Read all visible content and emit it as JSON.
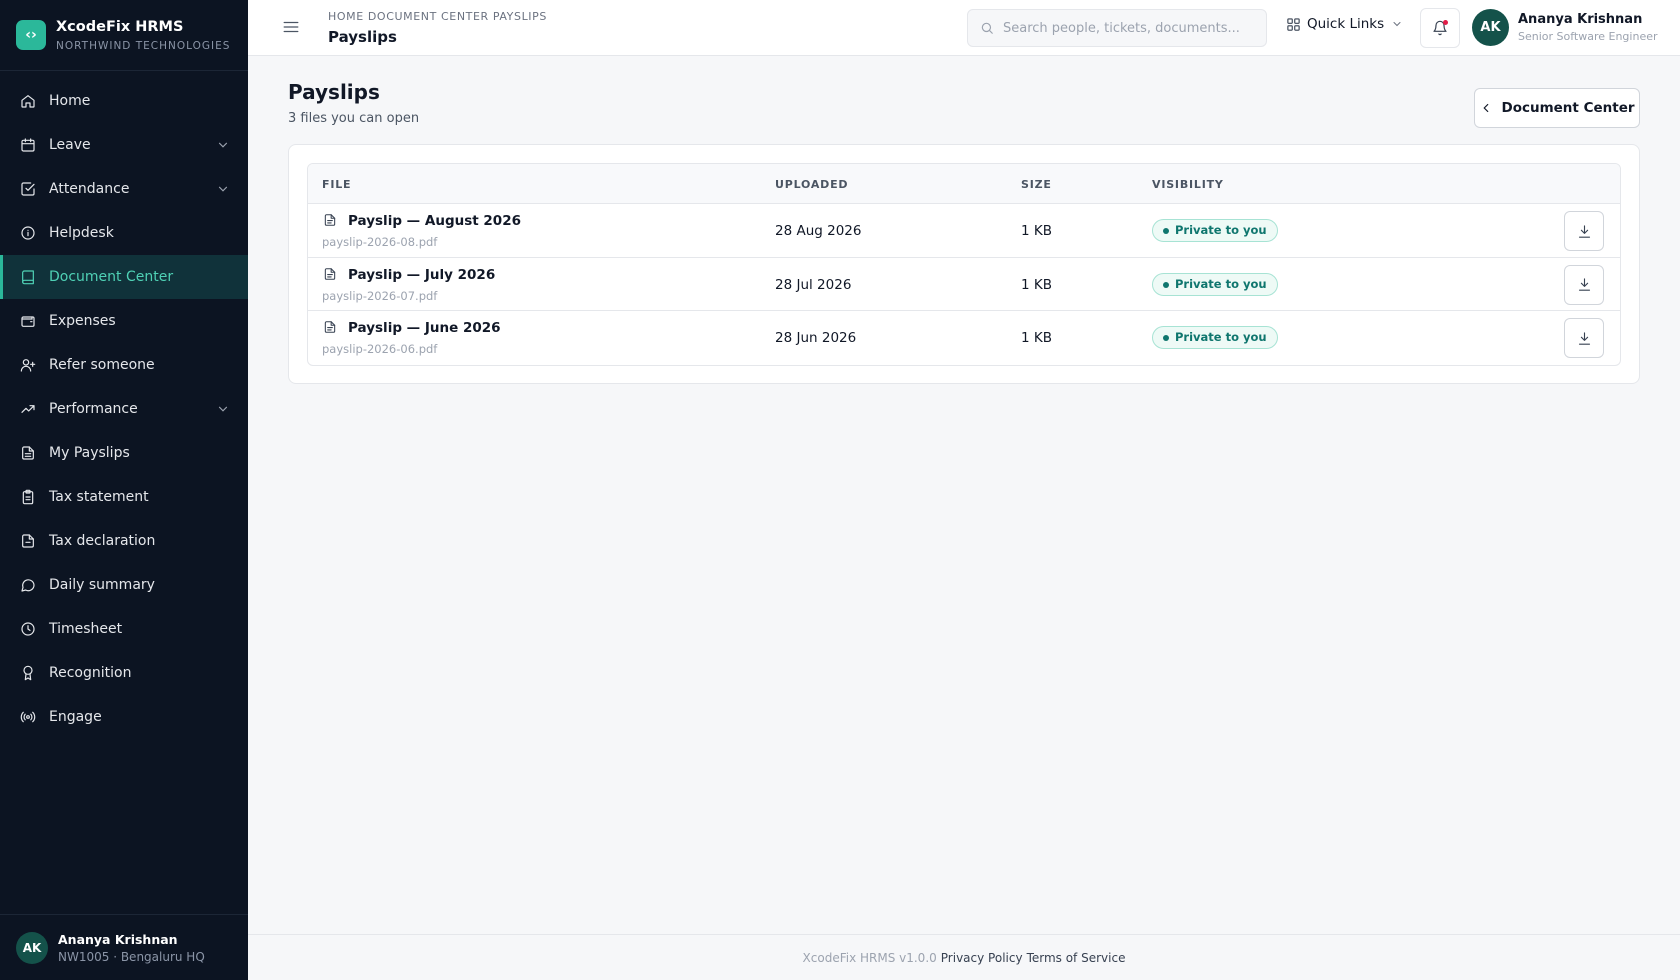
{
  "brand": {
    "name": "XcodeFix HRMS",
    "org": "NORTHWIND TECHNOLOGIES",
    "logo_glyph": "‹›",
    "accent": "#2bb89a"
  },
  "sidebar": {
    "items": [
      {
        "label": "Home",
        "icon": "home-icon"
      },
      {
        "label": "Leave",
        "icon": "calendar-icon",
        "expandable": true
      },
      {
        "label": "Attendance",
        "icon": "check-square-icon",
        "expandable": true
      },
      {
        "label": "Helpdesk",
        "icon": "info-icon"
      },
      {
        "label": "Document Center",
        "icon": "book-icon",
        "active": true
      },
      {
        "label": "Expenses",
        "icon": "wallet-icon"
      },
      {
        "label": "Refer someone",
        "icon": "user-plus-icon"
      },
      {
        "label": "Performance",
        "icon": "trending-up-icon",
        "expandable": true
      },
      {
        "label": "My Payslips",
        "icon": "file-text-icon"
      },
      {
        "label": "Tax statement",
        "icon": "clipboard-icon"
      },
      {
        "label": "Tax declaration",
        "icon": "file-icon"
      },
      {
        "label": "Daily summary",
        "icon": "message-circle-icon"
      },
      {
        "label": "Timesheet",
        "icon": "clock-icon"
      },
      {
        "label": "Recognition",
        "icon": "award-icon"
      },
      {
        "label": "Engage",
        "icon": "radio-icon"
      }
    ],
    "user": {
      "initials": "AK",
      "name": "Ananya Krishnan",
      "meta": "NW1005 · Bengaluru HQ"
    }
  },
  "header": {
    "breadcrumb": "HOME DOCUMENT CENTER PAYSLIPS",
    "title": "Payslips",
    "search_placeholder": "Search people, tickets, documents...",
    "quick_links": "Quick Links",
    "user": {
      "initials": "AK",
      "name": "Ananya Krishnan",
      "role": "Senior Software Engineer"
    }
  },
  "main": {
    "title": "Payslips",
    "subtitle": "3 files you can open",
    "back_label": "Document Center",
    "columns": {
      "file": "FILE",
      "uploaded": "UPLOADED",
      "size": "SIZE",
      "visibility": "VISIBILITY"
    },
    "rows": [
      {
        "name": "Payslip — August 2026",
        "file": "payslip-2026-08.pdf",
        "uploaded": "28 Aug 2026",
        "size": "1 KB",
        "visibility": "Private to you"
      },
      {
        "name": "Payslip — July 2026",
        "file": "payslip-2026-07.pdf",
        "uploaded": "28 Jul 2026",
        "size": "1 KB",
        "visibility": "Private to you"
      },
      {
        "name": "Payslip — June 2026",
        "file": "payslip-2026-06.pdf",
        "uploaded": "28 Jun 2026",
        "size": "1 KB",
        "visibility": "Private to you"
      }
    ]
  },
  "footer": {
    "version": "XcodeFix HRMS v1.0.0",
    "privacy": "Privacy Policy",
    "terms": "Terms of Service"
  }
}
